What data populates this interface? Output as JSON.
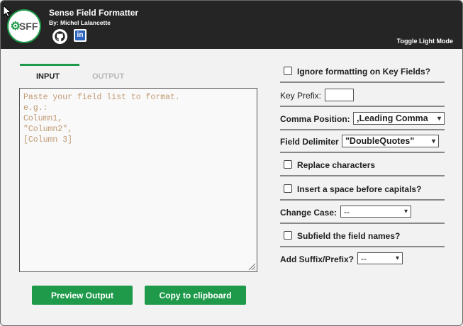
{
  "app": {
    "title": "Sense Field Formatter",
    "author": "By: Michel Lalancette",
    "logo_text": "SFF",
    "toggle_label": "Toggle Light Mode"
  },
  "tabs": {
    "input_label": "INPUT",
    "output_label": "OUTPUT"
  },
  "editor": {
    "placeholder": "Paste your field list to format.\ne.g.:\nColumn1,\n\"Column2\",\n[Column 3]"
  },
  "actions": {
    "preview_label": "Preview Output",
    "copy_label": "Copy to clipboard"
  },
  "options": {
    "ignore_key_fields_label": "Ignore formatting on Key Fields?",
    "key_prefix_label": "Key Prefix:",
    "key_prefix_value": "",
    "comma_position_label": "Comma Position:",
    "comma_position_value": ",Leading Comma",
    "field_delimiter_label": "Field Delimiter",
    "field_delimiter_value": "\"DoubleQuotes\"",
    "replace_chars_label": "Replace characters",
    "insert_space_label": "Insert a space before capitals?",
    "change_case_label": "Change Case:",
    "change_case_value": "--",
    "subfield_label": "Subfield the field names?",
    "suffix_prefix_label": "Add Suffix/Prefix?",
    "suffix_prefix_value": "--"
  },
  "colors": {
    "accent": "#1e9a4a",
    "header_bg": "#252525",
    "placeholder_text": "#c19a72"
  }
}
